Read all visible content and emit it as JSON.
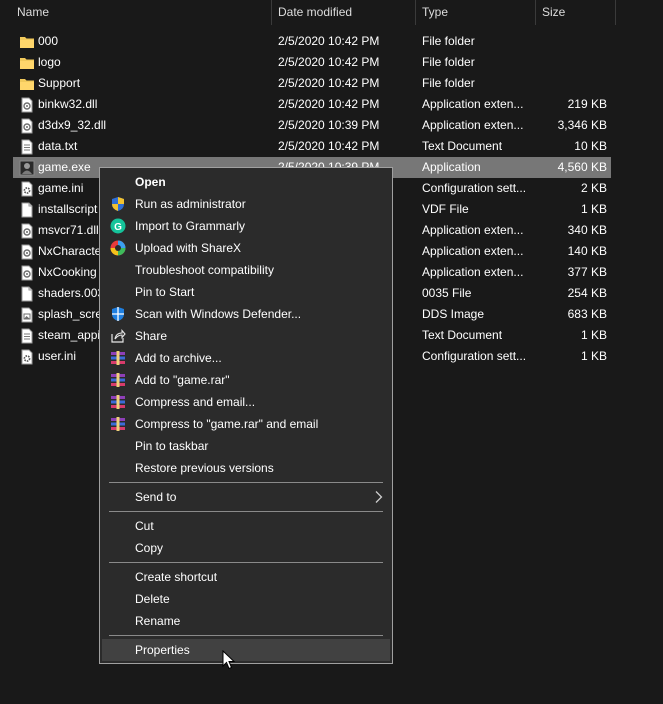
{
  "columns": {
    "name": "Name",
    "date": "Date modified",
    "type": "Type",
    "size": "Size"
  },
  "files": [
    {
      "name": "000",
      "date": "2/5/2020 10:42 PM",
      "type": "File folder",
      "size": "",
      "icon": "folder-icon"
    },
    {
      "name": "logo",
      "date": "2/5/2020 10:42 PM",
      "type": "File folder",
      "size": "",
      "icon": "folder-icon"
    },
    {
      "name": "Support",
      "date": "2/5/2020 10:42 PM",
      "type": "File folder",
      "size": "",
      "icon": "folder-icon"
    },
    {
      "name": "binkw32.dll",
      "date": "2/5/2020 10:42 PM",
      "type": "Application exten...",
      "size": "219 KB",
      "icon": "dll-file-icon"
    },
    {
      "name": "d3dx9_32.dll",
      "date": "2/5/2020 10:39 PM",
      "type": "Application exten...",
      "size": "3,346 KB",
      "icon": "dll-file-icon"
    },
    {
      "name": "data.txt",
      "date": "2/5/2020 10:42 PM",
      "type": "Text Document",
      "size": "10 KB",
      "icon": "text-file-icon"
    },
    {
      "name": "game.exe",
      "date": "2/5/2020 10:39 PM",
      "type": "Application",
      "size": "4,560 KB",
      "icon": "game-exe-icon"
    },
    {
      "name": "game.ini",
      "date": "",
      "type": "Configuration sett...",
      "size": "2 KB",
      "icon": "config-file-icon"
    },
    {
      "name": "installscript",
      "date": "",
      "type": "VDF File",
      "size": "1 KB",
      "icon": "blank-file-icon"
    },
    {
      "name": "msvcr71.dll",
      "date": "",
      "type": "Application exten...",
      "size": "340 KB",
      "icon": "dll-file-icon"
    },
    {
      "name": "NxCharacte",
      "date": "",
      "type": "Application exten...",
      "size": "140 KB",
      "icon": "dll-file-icon"
    },
    {
      "name": "NxCooking",
      "date": "",
      "type": "Application exten...",
      "size": "377 KB",
      "icon": "dll-file-icon"
    },
    {
      "name": "shaders.003",
      "date": "",
      "type": "0035 File",
      "size": "254 KB",
      "icon": "blank-file-icon"
    },
    {
      "name": "splash_scre",
      "date": "",
      "type": "DDS Image",
      "size": "683 KB",
      "icon": "image-file-icon"
    },
    {
      "name": "steam_appi",
      "date": "",
      "type": "Text Document",
      "size": "1 KB",
      "icon": "text-file-icon"
    },
    {
      "name": "user.ini",
      "date": "",
      "type": "Configuration sett...",
      "size": "1 KB",
      "icon": "config-file-icon"
    }
  ],
  "menu": [
    {
      "label": "Open",
      "bold": true,
      "icon": ""
    },
    {
      "label": "Run as administrator",
      "icon": "uac-shield-icon"
    },
    {
      "label": "Import to Grammarly",
      "icon": "grammarly-icon"
    },
    {
      "label": "Upload with ShareX",
      "icon": "sharex-icon"
    },
    {
      "label": "Troubleshoot compatibility",
      "icon": ""
    },
    {
      "label": "Pin to Start",
      "icon": ""
    },
    {
      "label": "Scan with Windows Defender...",
      "icon": "defender-icon"
    },
    {
      "label": "Share",
      "icon": "share-icon"
    },
    {
      "label": "Add to archive...",
      "icon": "winrar-icon"
    },
    {
      "label": "Add to \"game.rar\"",
      "icon": "winrar-icon"
    },
    {
      "label": "Compress and email...",
      "icon": "winrar-icon"
    },
    {
      "label": "Compress to \"game.rar\" and email",
      "icon": "winrar-icon"
    },
    {
      "label": "Pin to taskbar",
      "icon": ""
    },
    {
      "label": "Restore previous versions",
      "icon": ""
    },
    {
      "separator": true
    },
    {
      "label": "Send to",
      "icon": "",
      "submenu": true
    },
    {
      "separator": true
    },
    {
      "label": "Cut",
      "icon": ""
    },
    {
      "label": "Copy",
      "icon": ""
    },
    {
      "separator": true
    },
    {
      "label": "Create shortcut",
      "icon": ""
    },
    {
      "label": "Delete",
      "icon": ""
    },
    {
      "label": "Rename",
      "icon": ""
    },
    {
      "separator": true
    },
    {
      "label": "Properties",
      "icon": "",
      "hover": true
    }
  ],
  "colors": {
    "background": "#191919",
    "selected_row": "#777777",
    "menu_bg": "#2b2b2b",
    "menu_hover": "#414141",
    "folder": "#f1c95b"
  }
}
